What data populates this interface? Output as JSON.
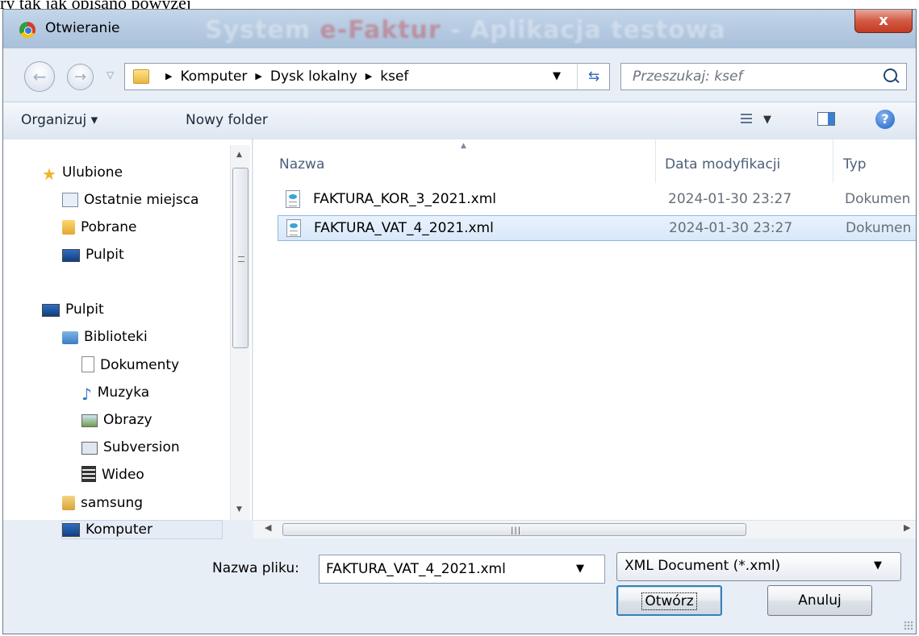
{
  "document_caption": "ry tak jak opisano powyżej",
  "background_app_title_left": "System ",
  "background_app_title_brand": "e-Faktur",
  "background_app_title_right": " - Aplikacja testowa",
  "dialog": {
    "title": "Otwieranie",
    "close_label": "x"
  },
  "address_bar": {
    "breadcrumbs": [
      "Komputer",
      "Dysk lokalny",
      "ksef"
    ]
  },
  "search": {
    "placeholder": "Przeszukaj: ksef"
  },
  "toolbar": {
    "organize_label": "Organizuj ▾",
    "new_folder_label": "Nowy folder",
    "help_label": "?"
  },
  "nav_pane": {
    "favorites_label": "Ulubione",
    "items": [
      {
        "label": "Ostatnie miejsca",
        "icon": "recent-places-icon"
      },
      {
        "label": "Pobrane",
        "icon": "downloads-icon"
      },
      {
        "label": "Pulpit",
        "icon": "desktop-icon"
      },
      {
        "label": "Pulpit",
        "icon": "desktop-icon"
      },
      {
        "label": "Biblioteki",
        "icon": "libraries-icon"
      },
      {
        "label": "Dokumenty",
        "icon": "documents-icon"
      },
      {
        "label": "Muzyka",
        "icon": "music-icon"
      },
      {
        "label": "Obrazy",
        "icon": "pictures-icon"
      },
      {
        "label": "Subversion",
        "icon": "subversion-icon"
      },
      {
        "label": "Wideo",
        "icon": "video-icon"
      },
      {
        "label": "samsung",
        "icon": "user-folder-icon"
      },
      {
        "label": "Komputer",
        "icon": "computer-icon"
      }
    ]
  },
  "file_list": {
    "columns": [
      "Nazwa",
      "Data modyfikacji",
      "Typ"
    ],
    "rows": [
      {
        "name": "FAKTURA_KOR_3_2021.xml",
        "date": "2024-01-30 23:27",
        "type": "Dokumen",
        "selected": false
      },
      {
        "name": "FAKTURA_VAT_4_2021.xml",
        "date": "2024-01-30 23:27",
        "type": "Dokumen",
        "selected": true
      }
    ]
  },
  "footer": {
    "file_name_label": "Nazwa pliku:",
    "file_name_value": "FAKTURA_VAT_4_2021.xml",
    "file_type_value": "XML Document (*.xml)",
    "open_label": "Otwórz",
    "cancel_label": "Anuluj"
  },
  "colors": {
    "selection": "#d8e8f9",
    "close_button": "#c23a22",
    "title_bar": "#b7cbe2"
  }
}
